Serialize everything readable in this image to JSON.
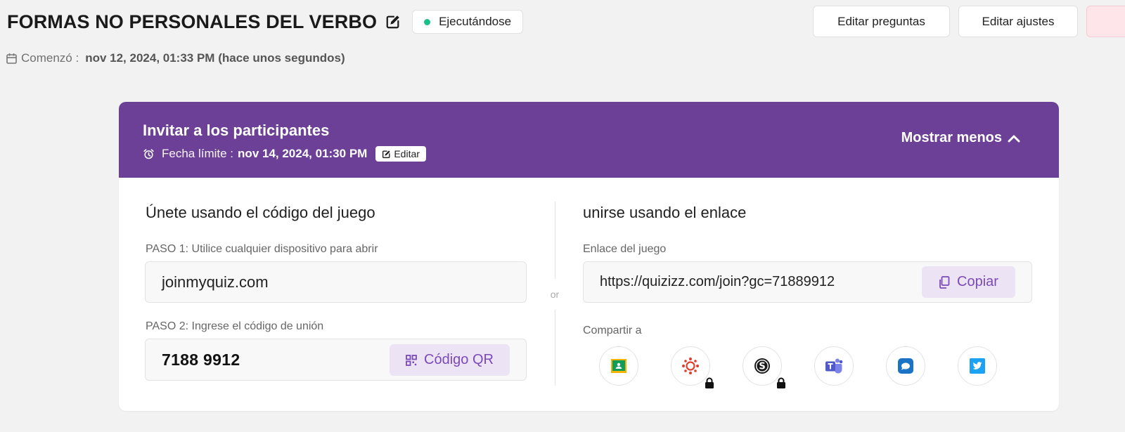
{
  "header": {
    "title": "FORMAS NO PERSONALES DEL VERBO",
    "status": "Ejecutándose",
    "status_color": "#19c187",
    "buttons": {
      "edit_questions": "Editar preguntas",
      "edit_settings": "Editar ajustes"
    },
    "started_label": "Comenzó :",
    "started_value": "nov 12, 2024, 01:33 PM (hace unos segundos)"
  },
  "invite": {
    "title": "Invitar a los participantes",
    "deadline_label": "Fecha límite :",
    "deadline_value": "nov 14, 2024, 01:30 PM",
    "edit_label": "Editar",
    "toggle_label": "Mostrar menos",
    "accent_color": "#6c4097"
  },
  "join_code": {
    "title": "Únete usando el código del juego",
    "step1_label": "PASO 1: Utilice cualquier dispositivo para abrir",
    "step1_value": "joinmyquiz.com",
    "step2_label": "PASO 2: Ingrese el código de unión",
    "code": "7188 9912",
    "qr_label": "Código QR"
  },
  "divider": {
    "or_label": "or"
  },
  "join_link": {
    "title": "unirse usando el enlace",
    "link_label": "Enlace del juego",
    "link_value": "https://quizizz.com/join?gc=71889912",
    "copy_label": "Copiar",
    "share_label": "Compartir a",
    "share_targets": [
      {
        "icon": "google-classroom-icon",
        "locked": false
      },
      {
        "icon": "canvas-icon",
        "locked": true
      },
      {
        "icon": "schoology-icon",
        "locked": true
      },
      {
        "icon": "microsoft-teams-icon",
        "locked": false
      },
      {
        "icon": "remind-icon",
        "locked": false
      },
      {
        "icon": "twitter-icon",
        "locked": false
      }
    ]
  }
}
